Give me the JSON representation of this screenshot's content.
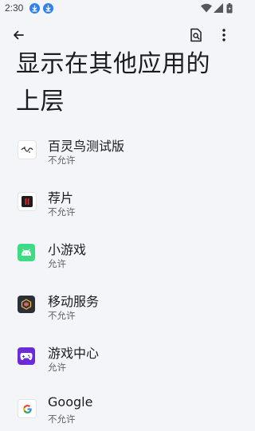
{
  "status_bar": {
    "time": "2:30",
    "notification_icons": [
      "download-icon",
      "download-icon"
    ],
    "system_icons": [
      "wifi-icon",
      "signal-icon",
      "battery-icon"
    ]
  },
  "toolbar": {
    "back_icon": "back-arrow-icon",
    "search_icon": "search-settings-icon",
    "menu_icon": "more-vert-icon"
  },
  "page": {
    "title": "显示在其他应用的上层"
  },
  "apps": [
    {
      "name": "百灵鸟测试版",
      "status": "不允许",
      "icon": "bailingniao-app-icon"
    },
    {
      "name": "荐片",
      "status": "不允许",
      "icon": "jianpian-app-icon"
    },
    {
      "name": "小游戏",
      "status": "允许",
      "icon": "android-app-icon"
    },
    {
      "name": "移动服务",
      "status": "不允许",
      "icon": "mobile-services-app-icon"
    },
    {
      "name": "游戏中心",
      "status": "允许",
      "icon": "game-center-app-icon"
    },
    {
      "name": "Google",
      "status": "不允许",
      "icon": "google-app-icon"
    }
  ],
  "colors": {
    "background": "#f4f5f9",
    "text_primary": "#1c1c1f",
    "text_secondary": "#606066",
    "download_badge": "#2f80ed"
  }
}
